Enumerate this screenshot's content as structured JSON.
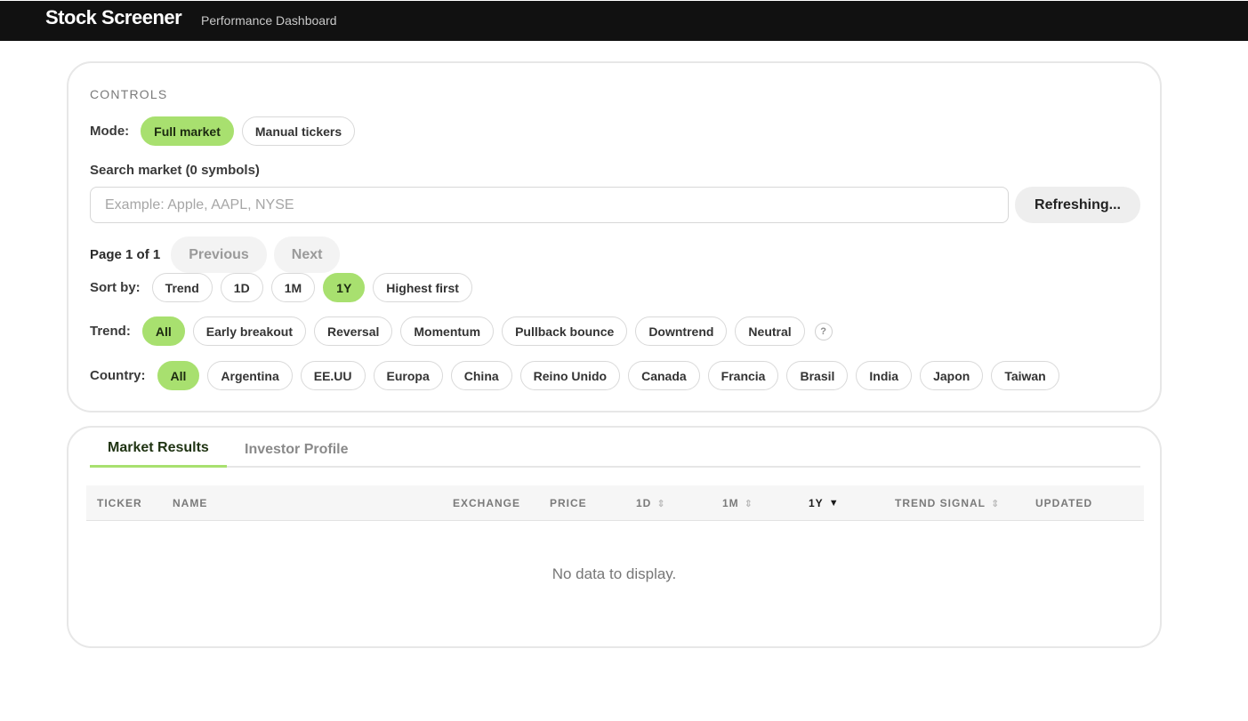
{
  "app": {
    "title": "Stock Screener",
    "subtitle": "Performance Dashboard"
  },
  "controls": {
    "section_label": "CONTROLS",
    "mode": {
      "label": "Mode:",
      "options": [
        "Full market",
        "Manual tickers"
      ],
      "selected": "Full market"
    },
    "search": {
      "label": "Search market (0 symbols)",
      "placeholder": "Example: Apple, AAPL, NYSE",
      "value": "",
      "refresh_label": "Refreshing..."
    },
    "pagination": {
      "info": "Page 1 of 1",
      "previous_label": "Previous",
      "next_label": "Next"
    },
    "sort": {
      "label": "Sort by:",
      "options": [
        "Trend",
        "1D",
        "1M",
        "1Y",
        "Highest first"
      ],
      "selected": "1Y"
    },
    "trend": {
      "label": "Trend:",
      "options": [
        "All",
        "Early breakout",
        "Reversal",
        "Momentum",
        "Pullback bounce",
        "Downtrend",
        "Neutral"
      ],
      "selected": "All",
      "help_label": "?"
    },
    "country": {
      "label": "Country:",
      "options": [
        "All",
        "Argentina",
        "EE.UU",
        "Europa",
        "China",
        "Reino Unido",
        "Canada",
        "Francia",
        "Brasil",
        "India",
        "Japon",
        "Taiwan"
      ],
      "selected": "All"
    }
  },
  "results": {
    "tabs": [
      "Market Results",
      "Investor Profile"
    ],
    "active_tab": "Market Results",
    "columns": [
      {
        "label": "TICKER",
        "sort": ""
      },
      {
        "label": "NAME",
        "sort": ""
      },
      {
        "label": "EXCHANGE",
        "sort": ""
      },
      {
        "label": "PRICE",
        "sort": ""
      },
      {
        "label": "1D",
        "sort": "⇕"
      },
      {
        "label": "1M",
        "sort": "⇕"
      },
      {
        "label": "1Y",
        "sort": "▼"
      },
      {
        "label": "TREND SIGNAL",
        "sort": "⇕"
      },
      {
        "label": "UPDATED",
        "sort": ""
      }
    ],
    "sorted_column": "1Y",
    "rows": [],
    "empty_message": "No data to display."
  },
  "colors": {
    "accent": "#a8e06f",
    "topbar": "#111111"
  }
}
